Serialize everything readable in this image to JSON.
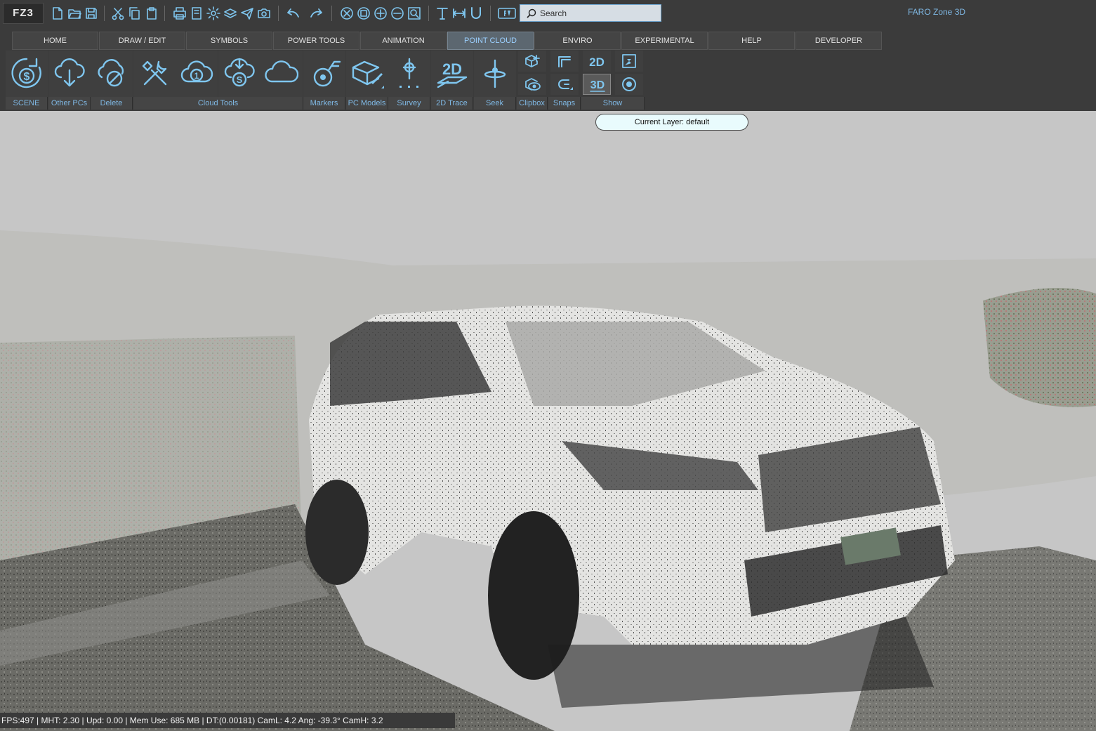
{
  "app": {
    "logo": "FZ3",
    "title": "FARO Zone 3D"
  },
  "search": {
    "placeholder": "Search"
  },
  "tabs": [
    {
      "label": "HOME"
    },
    {
      "label": "DRAW / EDIT"
    },
    {
      "label": "SYMBOLS"
    },
    {
      "label": "POWER TOOLS"
    },
    {
      "label": "ANIMATION"
    },
    {
      "label": "POINT CLOUD",
      "active": true
    },
    {
      "label": "ENVIRO"
    },
    {
      "label": "EXPERIMENTAL"
    },
    {
      "label": "HELP"
    },
    {
      "label": "DEVELOPER"
    }
  ],
  "ribbon_groups": [
    {
      "label": "SCENE"
    },
    {
      "label": "Other PCs"
    },
    {
      "label": "Delete"
    },
    {
      "label": "Cloud Tools"
    },
    {
      "label": "Markers"
    },
    {
      "label": "PC Models"
    },
    {
      "label": "Survey"
    },
    {
      "label": "2D Trace"
    },
    {
      "label": "Seek"
    },
    {
      "label": "Clipbox"
    },
    {
      "label": "Snaps"
    },
    {
      "label": "Show"
    }
  ],
  "show_buttons": {
    "view_2d": "2D",
    "view_3d": "3D",
    "trace_2d": "2D"
  },
  "layer": {
    "text": "Current Layer: default"
  },
  "status": {
    "text": "FPS:497 | MHT: 2.30 | Upd: 0.00 | Mem Use: 685 MB | DT:(0.00181)  CamL: 4.2   Ang: -39.3°  CamH: 3.2"
  },
  "colors": {
    "chrome": "#3b3b3b",
    "accent": "#7fc6ef",
    "active_tab": "#5c6770",
    "viewport": "#c6c6c6"
  }
}
